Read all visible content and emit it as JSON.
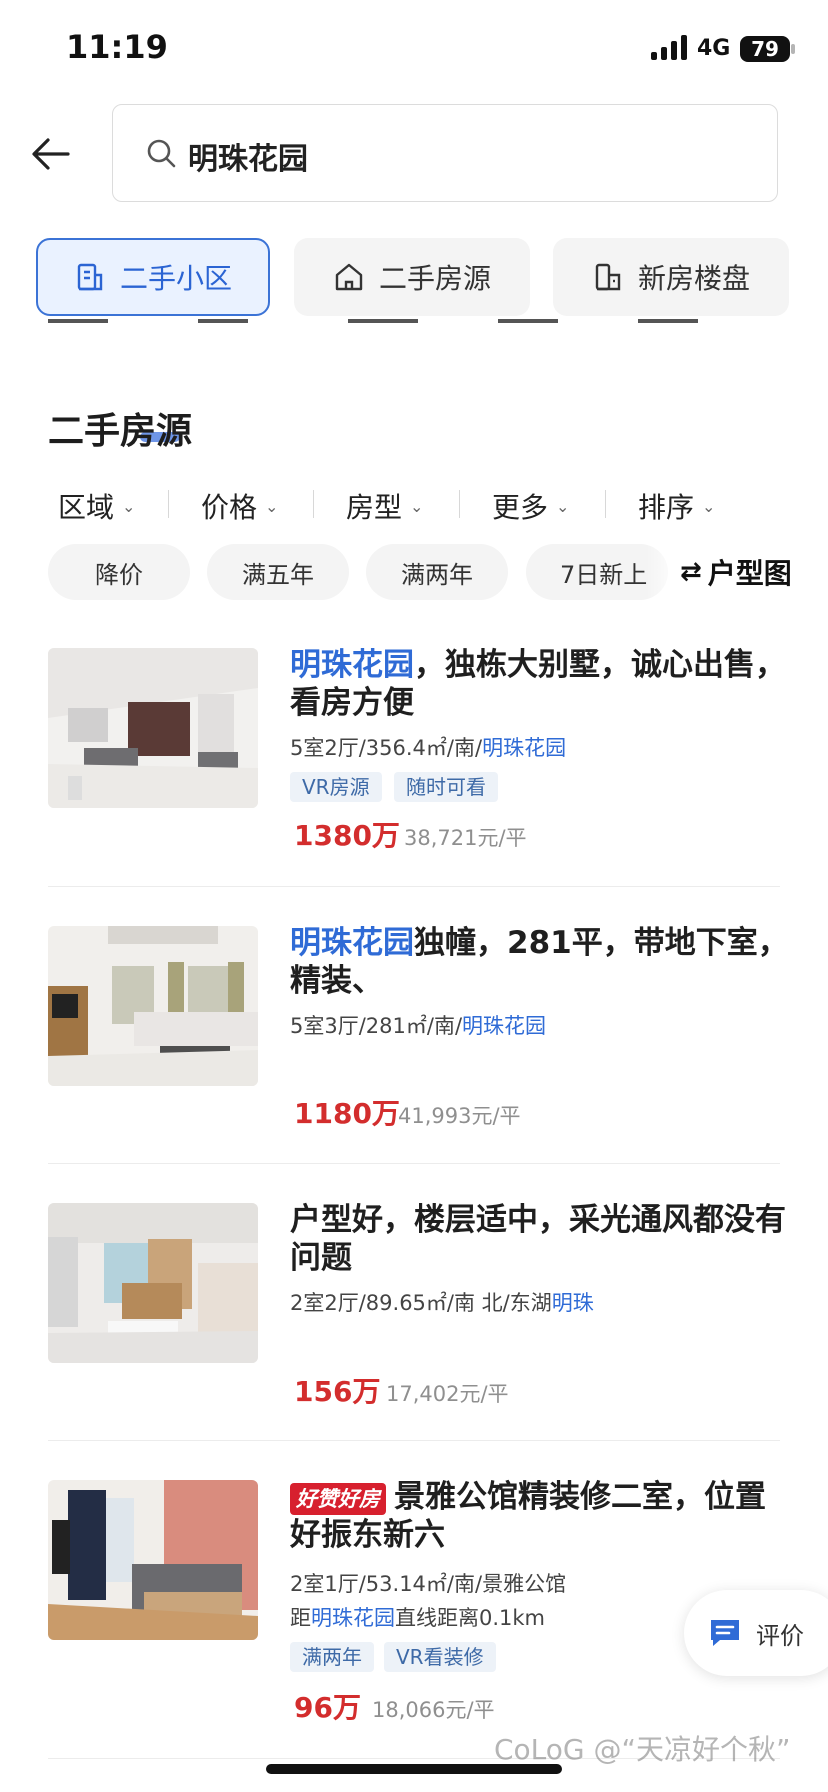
{
  "status_bar": {
    "time": "11:19",
    "network": "4G",
    "battery": "79"
  },
  "search": {
    "query": "明珠花园"
  },
  "categories": [
    {
      "label": "二手小区",
      "icon": "building-icon",
      "active": true
    },
    {
      "label": "二手房源",
      "icon": "house-icon",
      "active": false
    },
    {
      "label": "新房楼盘",
      "icon": "new-building-icon",
      "active": false
    }
  ],
  "section": {
    "title": "二手房源"
  },
  "filters": [
    "区域",
    "价格",
    "房型",
    "更多",
    "排序"
  ],
  "quick_tags": [
    "降价",
    "满五年",
    "满两年",
    "7日新上"
  ],
  "floor_plan_label": "户型图",
  "listings": [
    {
      "title_highlight": "明珠花园",
      "title_rest": "，独栋大别墅，诚心出售，看房方便",
      "meta_prefix": "5室2厅/356.4㎡/南/",
      "meta_link": "明珠花园",
      "tags": [
        "VR房源",
        "随时可看"
      ],
      "price": "1380万",
      "unit_price": "38,721元/平"
    },
    {
      "title_highlight": "明珠花园",
      "title_rest": "独幢，281平，带地下室，精装、",
      "meta_prefix": "5室3厅/281㎡/南/",
      "meta_link": "明珠花园",
      "tags": [],
      "price": "1180万",
      "unit_price": "41,993元/平"
    },
    {
      "title_highlight": "",
      "title_rest": "户型好，楼层适中，采光通风都没有问题",
      "meta_prefix": "2室2厅/89.65㎡/南 北/东湖",
      "meta_link": "明珠",
      "tags": [],
      "price": "156万",
      "unit_price": "17,402元/平"
    },
    {
      "badge": "好赞好房",
      "title_highlight": "",
      "title_rest": "景雅公馆精装修二室，位置好振东新六",
      "meta_prefix": "2室1厅/53.14㎡/南/景雅公馆",
      "meta_link": "",
      "distance_prefix": "距",
      "distance_link": "明珠花园",
      "distance_suffix": "直线距离0.1km",
      "tags": [
        "满两年",
        "VR看装修"
      ],
      "price": "96万",
      "unit_price": "18,066元/平"
    }
  ],
  "review_button": {
    "label": "评价"
  },
  "watermark": "CoLoG @“天凉好个秋”",
  "colors": {
    "accent": "#2f6bd6",
    "price": "#d32d2d",
    "active_chip_bg": "#eaf2ff"
  }
}
